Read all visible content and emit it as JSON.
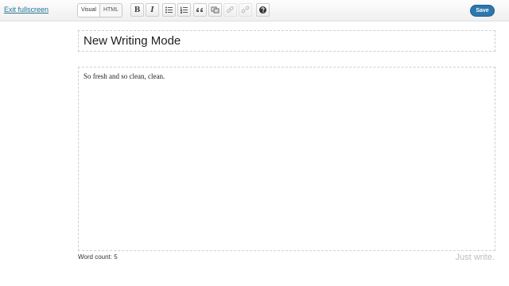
{
  "toolbar": {
    "exit_label": "Exit fullscreen",
    "mode_visual": "Visual",
    "mode_html": "HTML",
    "bold": "B",
    "italic": "I",
    "save_label": "Save"
  },
  "editor": {
    "title": "New Writing Mode",
    "content": "So fresh and so clean, clean."
  },
  "footer": {
    "word_count": "Word count: 5",
    "tagline": "Just write."
  },
  "colors": {
    "link": "#21759b",
    "save_button": "#2c78ad"
  }
}
